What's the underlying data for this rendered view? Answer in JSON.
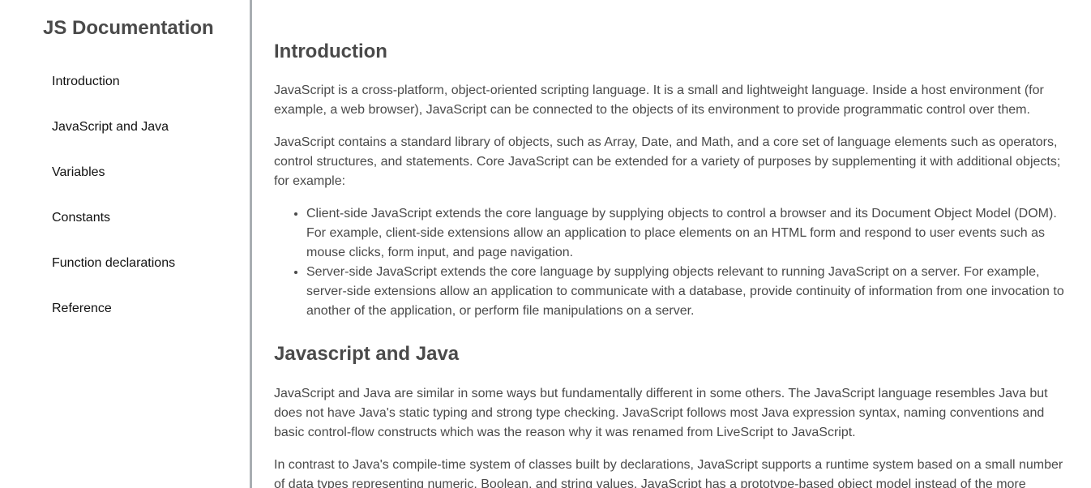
{
  "nav": {
    "title": "JS Documentation",
    "items": [
      {
        "label": "Introduction"
      },
      {
        "label": "JavaScript and Java"
      },
      {
        "label": "Variables"
      },
      {
        "label": "Constants"
      },
      {
        "label": "Function declarations"
      },
      {
        "label": "Reference"
      }
    ]
  },
  "sections": [
    {
      "title": "Introduction",
      "paragraphs": [
        "JavaScript is a cross-platform, object-oriented scripting language. It is a small and lightweight language. Inside a host environment (for example, a web browser), JavaScript can be connected to the objects of its environment to provide programmatic control over them.",
        "JavaScript contains a standard library of objects, such as Array, Date, and Math, and a core set of language elements such as operators, control structures, and statements. Core JavaScript can be extended for a variety of purposes by supplementing it with additional objects; for example:"
      ],
      "bullets": [
        "Client-side JavaScript extends the core language by supplying objects to control a browser and its Document Object Model (DOM). For example, client-side extensions allow an application to place elements on an HTML form and respond to user events such as mouse clicks, form input, and page navigation.",
        "Server-side JavaScript extends the core language by supplying objects relevant to running JavaScript on a server. For example, server-side extensions allow an application to communicate with a database, provide continuity of information from one invocation to another of the application, or perform file manipulations on a server."
      ]
    },
    {
      "title": "Javascript and Java",
      "paragraphs": [
        "JavaScript and Java are similar in some ways but fundamentally different in some others. The JavaScript language resembles Java but does not have Java's static typing and strong type checking. JavaScript follows most Java expression syntax, naming conventions and basic control-flow constructs which was the reason why it was renamed from LiveScript to JavaScript.",
        "In contrast to Java's compile-time system of classes built by declarations, JavaScript supports a runtime system based on a small number of data types representing numeric, Boolean, and string values. JavaScript has a prototype-based object model instead of the more"
      ]
    }
  ]
}
